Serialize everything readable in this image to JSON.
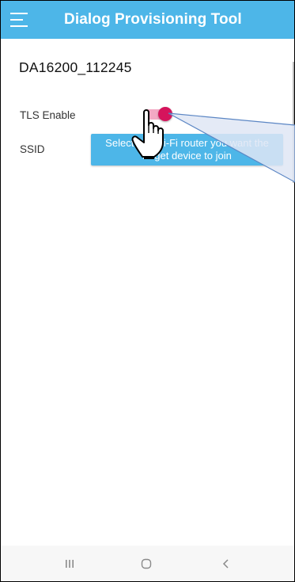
{
  "app_bar": {
    "title": "Dialog Provisioning Tool",
    "background_color": "#4db6e8",
    "menu_icon": "hamburger-menu-icon"
  },
  "device": {
    "name": "DA16200_112245"
  },
  "settings": {
    "tls_label": "TLS Enable",
    "tls_enabled": true,
    "tls_toggle_color": "#d5145c",
    "ssid_label": "SSID",
    "ssid_button_label": "Select the Wi-Fi router you want the target device to join"
  },
  "nav_bar": {
    "recents_icon": "recents-icon",
    "home_icon": "home-icon",
    "back_icon": "back-icon"
  },
  "overlay": {
    "pointer_icon": "hand-pointer-icon",
    "callout_color": "#5b86c4"
  }
}
